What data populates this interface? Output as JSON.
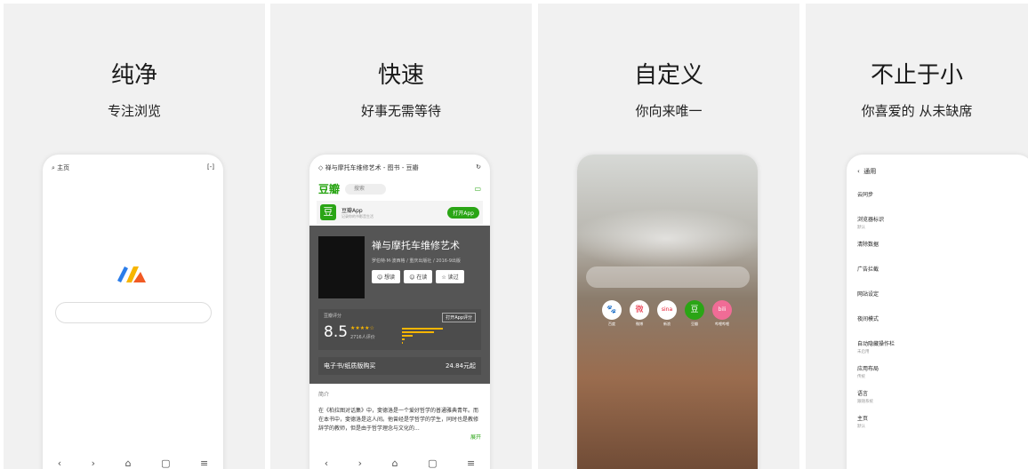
{
  "panels": [
    {
      "title": "纯净",
      "subtitle": "专注浏览"
    },
    {
      "title": "快速",
      "subtitle": "好事无需等待"
    },
    {
      "title": "自定义",
      "subtitle": "你向来唯一"
    },
    {
      "title": "不止于小",
      "subtitle": "你喜爱的 从未缺席"
    }
  ],
  "phone1": {
    "home_label": "主页"
  },
  "phone2": {
    "page_title": "禅与摩托车维修艺术 - 图书 - 豆瓣",
    "douban_logo": "豆瓣",
    "search_placeholder": "搜索",
    "app_name": "豆瓣App",
    "app_desc": "记录你的书影音生活",
    "open_app": "打开App",
    "book_title": "禅与摩托车维修艺术",
    "book_meta": "罗伯特·M·波西格 / 重庆出版社 / 2016-9出版",
    "btn_want": "想读",
    "btn_reading": "在读",
    "btn_read": "读过",
    "rating_label": "豆瓣评分",
    "rating_score": "8.5",
    "rating_stars": "★★★★☆",
    "rating_count": "2716人评价",
    "rating_open": "打开App评分",
    "ebook_label": "电子书/纸质版购买",
    "ebook_price": "24.84元起",
    "intro_heading": "简介",
    "intro_text": "在《柏拉图对话集》中，斐德洛是一个爱好哲学的普通雅典青年。而在本书中，斐德洛是这人间。他曾经是学哲学的学生，同时也是教修辞学的教师，但是由于哲学理念与文化的...",
    "intro_expand": "展开"
  },
  "phone3": {
    "shortcuts": [
      "百度",
      "微博",
      "新浪",
      "豆瓣",
      "哔哩哔哩"
    ],
    "shortcut_glyphs": [
      "🐾",
      "微",
      "sina",
      "豆",
      "bili"
    ]
  },
  "phone4": {
    "header": "通用",
    "items": [
      {
        "title": "云同步",
        "desc": ""
      },
      {
        "title": "浏览器标识",
        "desc": "默认"
      },
      {
        "title": "清除数据",
        "desc": ""
      },
      {
        "title": "广告拦截",
        "desc": ""
      },
      {
        "title": "网站设定",
        "desc": ""
      },
      {
        "title": "夜间模式",
        "desc": ""
      },
      {
        "title": "自动隐藏操作栏",
        "desc": "未启用"
      },
      {
        "title": "应用布局",
        "desc": "传统"
      },
      {
        "title": "语言",
        "desc": "跟随系统"
      },
      {
        "title": "主页",
        "desc": "默认"
      }
    ]
  },
  "nav_glyphs": [
    "‹",
    "›",
    "⌂",
    "▢",
    "≡"
  ]
}
